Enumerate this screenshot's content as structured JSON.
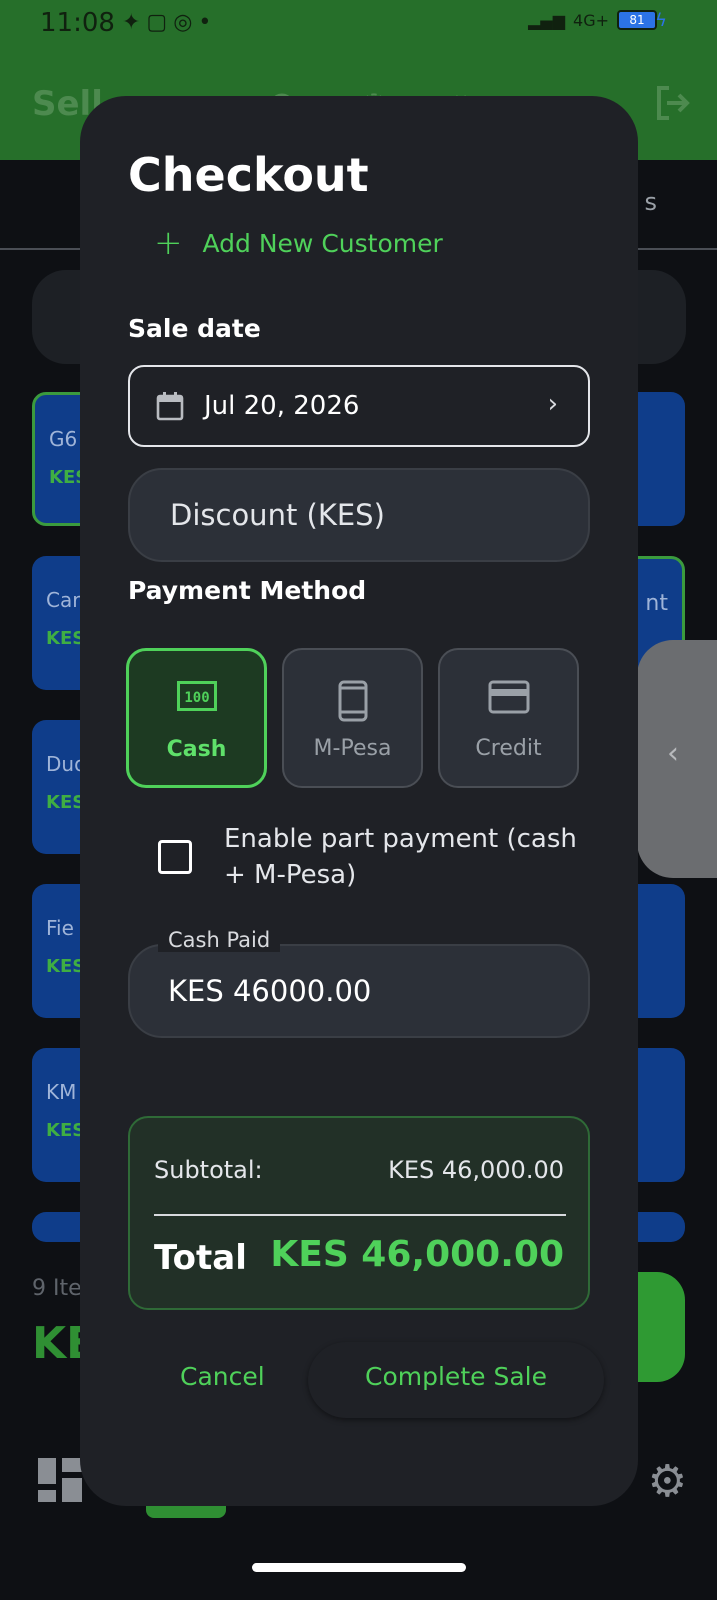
{
  "status_bar": {
    "time": "11:08",
    "battery": "81",
    "network": "4G+"
  },
  "app_bar": {
    "title": "Sell"
  },
  "background": {
    "tab_fragment": "s",
    "cards_left": [
      {
        "title": "G6",
        "price": "KES"
      },
      {
        "title": "Car",
        "price": "KES"
      },
      {
        "title": "Duo",
        "price": "KES"
      },
      {
        "title": "Fie",
        "price": "KES"
      },
      {
        "title": "KM",
        "price": "KES"
      }
    ],
    "card_right_fragment": "nt",
    "items_count": "9 Ite",
    "total_fragment": "KE"
  },
  "dialog": {
    "title": "Checkout",
    "add_customer": "Add New Customer",
    "sale_date_label": "Sale date",
    "sale_date_value": "Jul 20, 2026",
    "discount_placeholder": "Discount (KES)",
    "payment_method_label": "Payment Method",
    "payment_methods": [
      {
        "label": "Cash",
        "icon": "cash-icon",
        "selected": true
      },
      {
        "label": "M-Pesa",
        "icon": "phone-icon",
        "selected": false
      },
      {
        "label": "Credit",
        "icon": "credit-card-icon",
        "selected": false
      }
    ],
    "part_payment_label": "Enable part payment (cash + M-Pesa)",
    "part_payment_checked": false,
    "cash_paid_label": "Cash Paid",
    "cash_paid_value": "KES 46000.00",
    "summary": {
      "subtotal_label": "Subtotal:",
      "subtotal_value": "KES 46,000.00",
      "total_label": "Total",
      "total_value": "KES 46,000.00"
    },
    "cancel_label": "Cancel",
    "complete_label": "Complete Sale"
  },
  "colors": {
    "accent": "#4fd15a",
    "dialog_bg": "#1f2126",
    "app_bar": "#266f2a"
  }
}
